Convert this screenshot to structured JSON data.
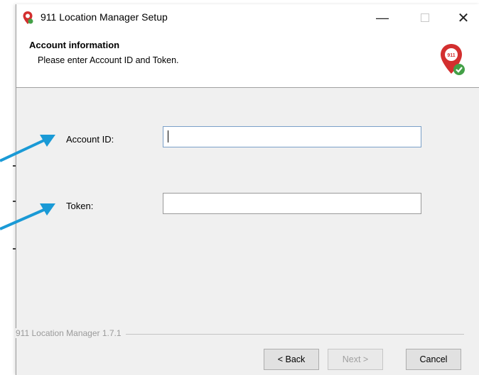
{
  "window": {
    "title": "911 Location Manager Setup",
    "minimize_glyph": "—",
    "close_glyph": "✕"
  },
  "header": {
    "title": "Account information",
    "subtitle": "Please enter Account ID and Token.",
    "icon": "911-pin-check-icon"
  },
  "form": {
    "account_label": "Account ID:",
    "account_value": "",
    "token_label": "Token:",
    "token_value": ""
  },
  "footer": {
    "version": "911 Location Manager 1.7.1",
    "back_label": "< Back",
    "next_label": "Next >",
    "cancel_label": "Cancel"
  },
  "colors": {
    "arrow": "#1a9ad6",
    "brand_red": "#d32f2f",
    "check_green": "#43a047"
  }
}
